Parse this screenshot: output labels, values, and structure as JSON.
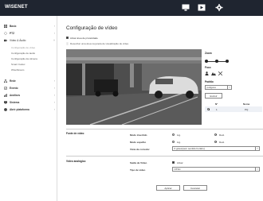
{
  "topbar": {
    "logo": "WISENET",
    "icons": [
      "monitor-icon",
      "playback-icon",
      "gear-icon"
    ]
  },
  "sidebar": {
    "items": [
      {
        "label": "Basic",
        "icon": "grid-icon",
        "expanded": false
      },
      {
        "label": "PTZ",
        "icon": "ptz-icon",
        "expanded": false
      },
      {
        "label": "Vídeo & Áudio",
        "icon": "video-icon",
        "expanded": true,
        "children": [
          {
            "label": "Configuração de vídeo",
            "active": true
          },
          {
            "label": "Configuração de áudio",
            "active": false
          },
          {
            "label": "Configuração da câmera",
            "active": false
          },
          {
            "label": "Smart Codec",
            "active": false
          },
          {
            "label": "WiseStream",
            "active": false
          }
        ]
      },
      {
        "label": "Rede",
        "icon": "network-icon",
        "expanded": false
      },
      {
        "label": "Evento",
        "icon": "event-icon",
        "expanded": false
      },
      {
        "label": "Análises",
        "icon": "analytics-icon",
        "expanded": false
      },
      {
        "label": "Sistema",
        "icon": "system-icon",
        "expanded": false
      },
      {
        "label": "Abrir plataforma",
        "icon": "platform-icon",
        "expanded": false
      }
    ]
  },
  "main": {
    "title": "Configuração de vídeo",
    "privacy_checkbox_label": "Ativar área de privacidade",
    "privacy_hint": "Desenhar uma área na janela de visualização de vídeo.",
    "zoom_label": "Zoom",
    "foco_label": "Foco",
    "padrao_label": "Padrão",
    "pattern_select": "polígono",
    "excluir_label": "Excluir",
    "table": {
      "headers": [
        "Nº",
        "Nome"
      ],
      "rows": [
        {
          "no": "1",
          "name": "PQ"
        }
      ]
    },
    "fonte": {
      "label": "Fonte de vídeo",
      "modo_invertido": "Modo invertido",
      "modo_espelho": "Modo espelho",
      "vista_corredor": "Vista de corredor",
      "opt_lig": "Lig.",
      "opt_desl": "Desl.",
      "corredor_value": "0 graus(sem sentido horário)"
    },
    "analog": {
      "label": "Vídeo analógico",
      "saida": "Saída de Vídeo",
      "ativar": "Ativar",
      "tipo": "Tipo de vídeo",
      "tipo_value": "NTSC"
    },
    "buttons": {
      "apply": "Aplicar",
      "cancel": "Cancelar"
    }
  }
}
